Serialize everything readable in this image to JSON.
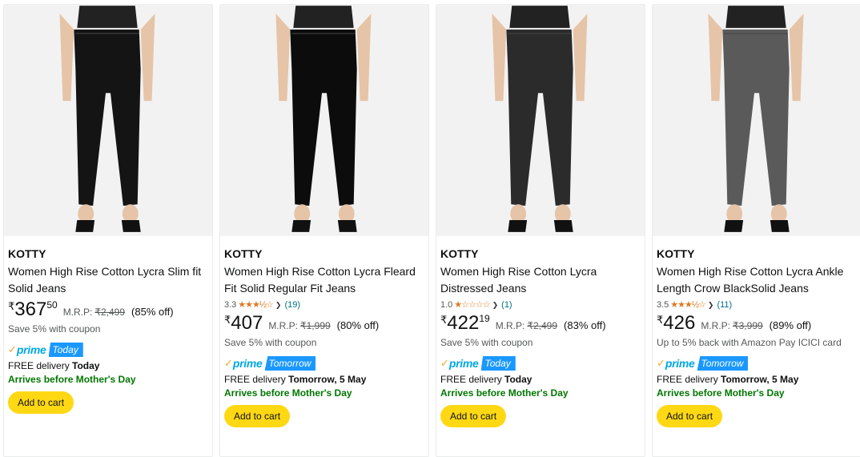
{
  "products": [
    {
      "brand": "KOTTY",
      "title": "Women High Rise Cotton Lycra Slim fit Solid Jeans",
      "rating": null,
      "price_symbol": "₹",
      "price_whole": "367",
      "price_fraction": "50",
      "mrp_label": "M.R.P:",
      "mrp": "₹2,499",
      "discount": "(85% off)",
      "offer": "Save 5% with coupon",
      "prime_label": "prime",
      "prime_badge": "Today",
      "delivery_prefix": "FREE delivery",
      "delivery_date": "Today",
      "arrives": "Arrives before Mother's Day",
      "cart_label": "Add to cart",
      "image_color": "#141414"
    },
    {
      "brand": "KOTTY",
      "title": "Women High Rise Cotton Lycra Fleard Fit Solid Regular Fit Jeans",
      "rating": {
        "value": "3.3",
        "stars": "★★★½☆",
        "count": "(19)"
      },
      "price_symbol": "₹",
      "price_whole": "407",
      "price_fraction": "",
      "mrp_label": "M.R.P:",
      "mrp": "₹1,999",
      "discount": "(80% off)",
      "offer": "Save 5% with coupon",
      "prime_label": "prime",
      "prime_badge": "Tomorrow",
      "delivery_prefix": "FREE delivery",
      "delivery_date": "Tomorrow, 5 May",
      "arrives": "Arrives before Mother's Day",
      "cart_label": "Add to cart",
      "image_color": "#0c0c0c"
    },
    {
      "brand": "KOTTY",
      "title": "Women High Rise Cotton Lycra Distressed Jeans",
      "rating": {
        "value": "1.0",
        "stars": "★☆☆☆☆",
        "count": "(1)"
      },
      "price_symbol": "₹",
      "price_whole": "422",
      "price_fraction": "19",
      "mrp_label": "M.R.P:",
      "mrp": "₹2,499",
      "discount": "(83% off)",
      "offer": "Save 5% with coupon",
      "prime_label": "prime",
      "prime_badge": "Today",
      "delivery_prefix": "FREE delivery",
      "delivery_date": "Today",
      "arrives": "Arrives before Mother's Day",
      "cart_label": "Add to cart",
      "image_color": "#2b2b2b"
    },
    {
      "brand": "KOTTY",
      "title": "Women High Rise Cotton Lycra Ankle Length Crow BlackSolid Jeans",
      "rating": {
        "value": "3.5",
        "stars": "★★★½☆",
        "count": "(11)"
      },
      "price_symbol": "₹",
      "price_whole": "426",
      "price_fraction": "",
      "mrp_label": "M.R.P:",
      "mrp": "₹3,999",
      "discount": "(89% off)",
      "offer": "Up to 5% back with Amazon Pay ICICI card",
      "prime_label": "prime",
      "prime_badge": "Tomorrow",
      "delivery_prefix": "FREE delivery",
      "delivery_date": "Tomorrow, 5 May",
      "arrives": "Arrives before Mother's Day",
      "cart_label": "Add to cart",
      "image_color": "#5a5a5a"
    }
  ],
  "colors": {
    "cart_button": "#ffd814",
    "prime_blue": "#1a98ff",
    "arrives_green": "#007600",
    "star_orange": "#de7921",
    "link_teal": "#007185"
  }
}
